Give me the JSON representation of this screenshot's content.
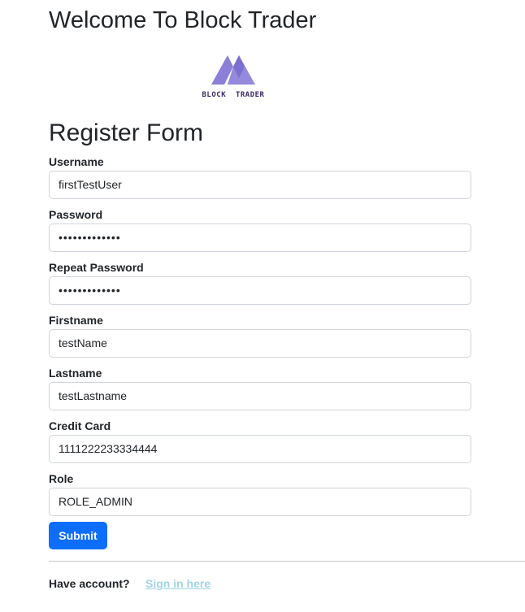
{
  "header": {
    "title": "Welcome To Block Trader"
  },
  "logo": {
    "text": "BLOCK  TRADER",
    "color": "#8b7fd9"
  },
  "form": {
    "title": "Register Form",
    "fields": [
      {
        "label": "Username",
        "value": "firstTestUser"
      },
      {
        "label": "Password",
        "value": "•••••••••••••"
      },
      {
        "label": "Repeat Password",
        "value": "•••••••••••••"
      },
      {
        "label": "Firstname",
        "value": "testName"
      },
      {
        "label": "Lastname",
        "value": "testLastname"
      },
      {
        "label": "Credit Card",
        "value": "1111222233334444"
      },
      {
        "label": "Role",
        "value": "ROLE_ADMIN"
      }
    ],
    "submit_label": "Submit"
  },
  "footer": {
    "have_account_text": "Have account?",
    "signin_link": "Sign in here"
  },
  "colors": {
    "primary": "#0d6efd",
    "link": "#9fd3e8",
    "logo": "#8b7fd9"
  }
}
